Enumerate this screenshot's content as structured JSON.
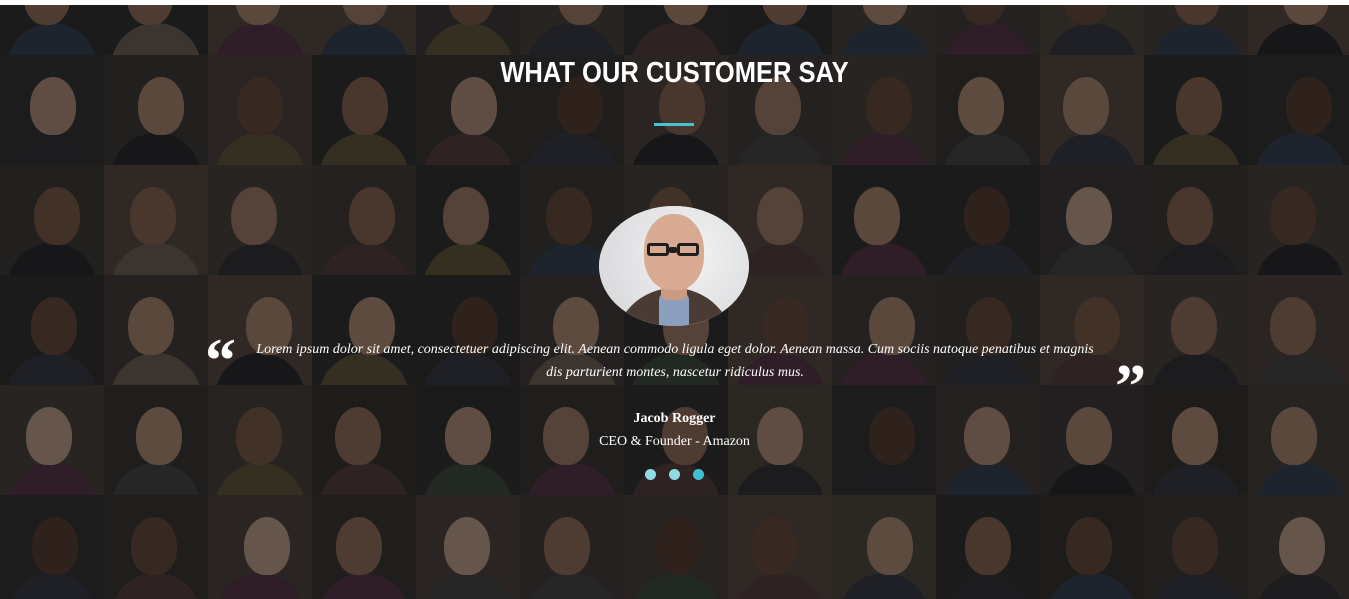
{
  "section": {
    "title": "WHAT OUR CUSTOMER SAY",
    "accent_color": "#41c4d4"
  },
  "testimonial": {
    "open_quote": "“",
    "close_quote": "”",
    "text": "Lorem ipsum dolor sit amet, consectetuer adipiscing elit. Aenean commodo ligula eget dolor. Aenean massa. Cum sociis natoque penatibus et magnis dis parturient montes, nascetur ridiculus mus.",
    "author_name": "Jacob Rogger",
    "author_role": "CEO & Founder - Amazon",
    "avatar_icon": "person-portrait-icon"
  },
  "carousel": {
    "slides": 3,
    "active_index": 2
  }
}
